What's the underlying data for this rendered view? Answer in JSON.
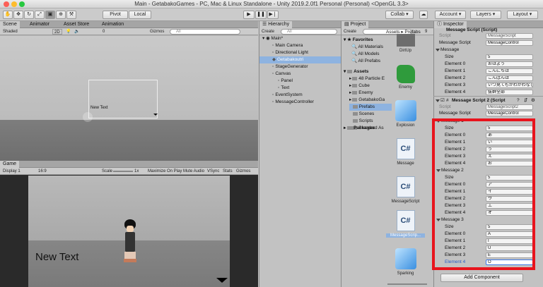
{
  "window": {
    "title": "Main - GetabakoGames - PC, Mac & Linux Standalone - Unity 2019.2.0f1 Personal (Personal) <OpenGL 3.3>"
  },
  "toolbar": {
    "pivot": "Pivot",
    "local": "Local",
    "collab": "Collab",
    "account": "Account",
    "layers": "Layers",
    "layout": "Layout"
  },
  "scene": {
    "tabs": [
      "Scene",
      "Animator",
      "Asset Store",
      "Animation"
    ],
    "shading": "Shaded",
    "mode_2d": "2D",
    "gizmos": "Gizmos",
    "search_placeholder": "All",
    "effects_count": "0",
    "canvas_text": "New Text"
  },
  "game": {
    "tab": "Game",
    "display": "Display 1",
    "aspect": "16:9",
    "scale_label": "Scale",
    "scale_value": "1x",
    "options": [
      "Maximize On Play",
      "Mute Audio",
      "VSync",
      "Stats",
      "Gizmos"
    ],
    "canvas_text": "New Text"
  },
  "hierarchy": {
    "tab": "Hierarchy",
    "create": "Create",
    "search_placeholder": "All",
    "root": "Main*",
    "items": [
      {
        "label": "Main Camera",
        "depth": 1
      },
      {
        "label": "Directional Light",
        "depth": 1
      },
      {
        "label": "Getabakoutri",
        "depth": 1,
        "selected": true
      },
      {
        "label": "StageGenerator",
        "depth": 1
      },
      {
        "label": "Canvas",
        "depth": 1
      },
      {
        "label": "Panel",
        "depth": 2
      },
      {
        "label": "Text",
        "depth": 2
      },
      {
        "label": "EventSystem",
        "depth": 1
      },
      {
        "label": "MessageController",
        "depth": 1
      }
    ]
  },
  "project": {
    "tab": "Project",
    "create": "Create",
    "badge": "9",
    "favorites": "Favorites",
    "fav_items": [
      "All Materials",
      "All Models",
      "All Prefabs"
    ],
    "assets": "Assets",
    "asset_items": [
      "48 Particle E",
      "Cube",
      "Enemy",
      "GetabakoGa",
      "Prefabs",
      "Scenes",
      "Scripts",
      "Standard As"
    ],
    "packages": "Packages",
    "breadcrumb": [
      "Assets",
      "Prefabs"
    ],
    "grid": [
      {
        "name": "DirtUp",
        "kind": "prefab"
      },
      {
        "name": "Enemy",
        "kind": "enemy"
      },
      {
        "name": "Explosion",
        "kind": "cube"
      },
      {
        "name": "Message",
        "kind": "script"
      },
      {
        "name": "MessageScript",
        "kind": "script"
      },
      {
        "name": "MessageScrip...",
        "kind": "script"
      },
      {
        "name": "Sparking",
        "kind": "cube"
      }
    ]
  },
  "inspector": {
    "tab": "Inspector",
    "comp1_title": "Message Script (Script)",
    "script_label": "Script",
    "script_value1": "MessageScript",
    "message_script_label": "Message Script",
    "message_script_value": "MessageControl",
    "message_label": "Message",
    "size_label": "Size",
    "first": {
      "size": "5",
      "elements": [
        "おはよう",
        "こんにちは",
        "こんばんは",
        "いつ見てもかわかわなし",
        "抜群全部"
      ]
    },
    "comp2_title": "Message Script 2 (Script",
    "script_value2": "MessageScript2",
    "groups": [
      {
        "title": "Message 1",
        "size": "5",
        "elements": [
          "あ",
          "い",
          "う",
          "え",
          "お"
        ]
      },
      {
        "title": "Message 2",
        "size": "5",
        "elements": [
          "ア",
          "イ",
          "ウ",
          "エ",
          "オ"
        ]
      },
      {
        "title": "Message 3",
        "size": "5",
        "elements": [
          "A",
          "I",
          "U",
          "E",
          "O"
        ]
      }
    ],
    "element_labels": [
      "Element 0",
      "Element 1",
      "Element 2",
      "Element 3",
      "Element 4"
    ],
    "add_component": "Add Component"
  }
}
